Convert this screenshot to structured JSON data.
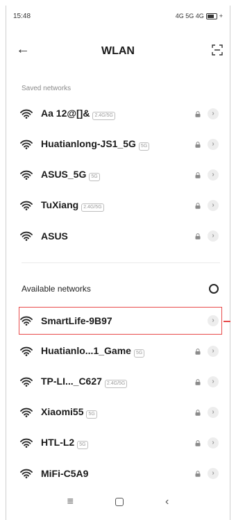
{
  "status_bar": {
    "time": "15:48",
    "indicators": "4G 5G 4G",
    "battery_suffix": "+"
  },
  "header": {
    "title": "WLAN",
    "back_icon": "arrow-left-icon",
    "action_icon": "scan-icon"
  },
  "saved": {
    "label": "Saved networks",
    "items": [
      {
        "name": "Aa 12@[]&",
        "badge": "2.4G/5G",
        "secured": true
      },
      {
        "name": "Huatianlong-JS1_5G",
        "badge": "5G",
        "secured": true
      },
      {
        "name": "ASUS_5G",
        "badge": "5G",
        "secured": true
      },
      {
        "name": "TuXiang",
        "badge": "2.4G/5G",
        "secured": true
      },
      {
        "name": "ASUS",
        "badge": "",
        "secured": true
      }
    ]
  },
  "available": {
    "label": "Available networks",
    "items": [
      {
        "name": "SmartLife-9B97",
        "badge": "",
        "secured": false
      },
      {
        "name": "Huatianlo...1_Game",
        "badge": "5G",
        "secured": true
      },
      {
        "name": "TP-LI..._C627",
        "badge": "2.4G/5G",
        "secured": true
      },
      {
        "name": "Xiaomi55",
        "badge": "5G",
        "secured": true
      },
      {
        "name": "HTL-L2",
        "badge": "5G",
        "secured": true
      },
      {
        "name": "MiFi-C5A9",
        "badge": "",
        "secured": true
      }
    ]
  },
  "colors": {
    "highlight": "#e84a4a",
    "chevron_bg": "#ededed"
  }
}
